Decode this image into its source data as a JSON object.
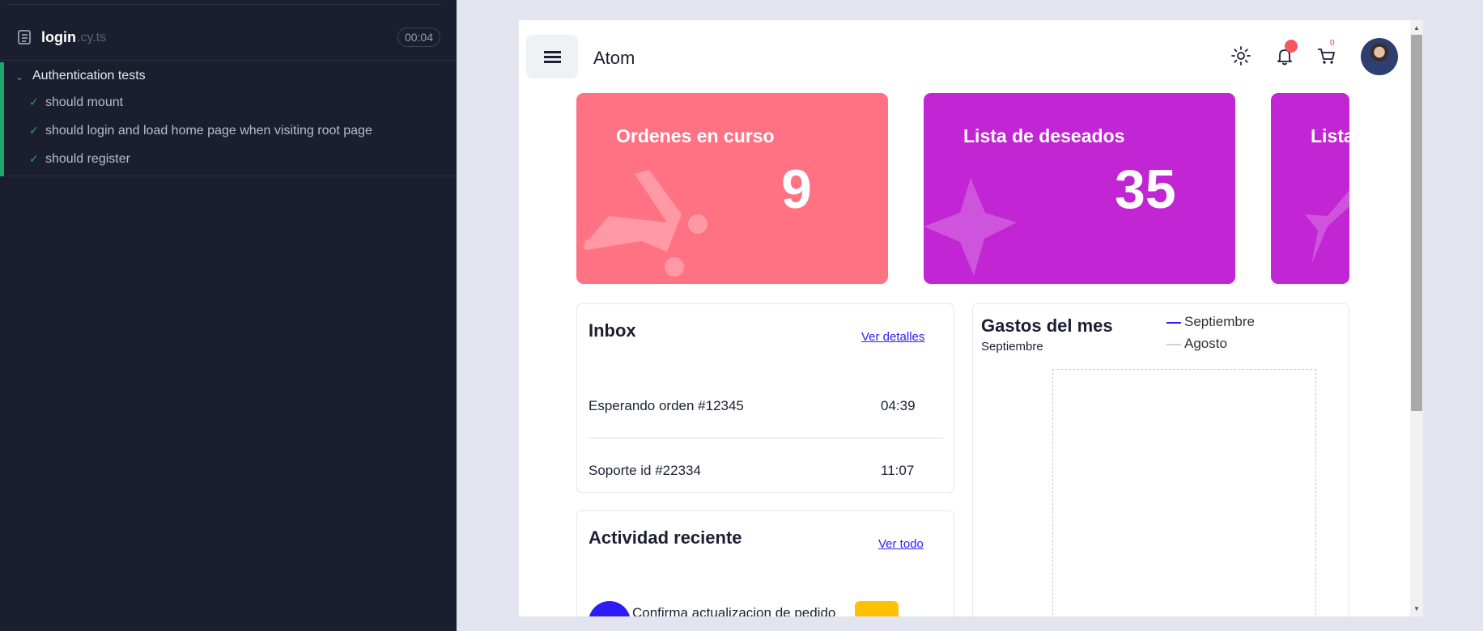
{
  "reporter": {
    "file_name": "login",
    "file_ext": ".cy.ts",
    "duration": "00:04",
    "suite_title": "Authentication tests",
    "tests": [
      "should mount",
      "should login and load home page when visiting root page",
      "should register"
    ],
    "pass_icon": "checkmark-icon",
    "pass_color": "#1fa971"
  },
  "header": {
    "title": "Atom",
    "cart_count": "0",
    "icons": [
      "menu-icon",
      "sun-icon",
      "bell-icon",
      "cart-icon",
      "avatar"
    ]
  },
  "cards": [
    {
      "label": "Ordenes en curso",
      "value": "9",
      "color": "#ff7284",
      "icon": "cart-icon"
    },
    {
      "label": "Lista de deseados",
      "value": "35",
      "color": "#c225d4",
      "icon": "star-icon"
    },
    {
      "label": "Lista",
      "color": "#c225d4",
      "icon": "star-icon"
    }
  ],
  "inbox": {
    "title": "Inbox",
    "link": "Ver detalles",
    "rows": [
      {
        "text": "Esperando orden #12345",
        "time": "04:39"
      },
      {
        "text": "Soporte id #22334",
        "time": "11:07"
      }
    ]
  },
  "activity": {
    "title": "Actividad reciente",
    "link": "Ver todo",
    "first_item": "Confirma actualizacion de pedido"
  },
  "expenses": {
    "title": "Gastos del mes",
    "subtitle": "Septiembre",
    "legend": [
      {
        "name": "Septiembre",
        "color": "#2d1cf5"
      },
      {
        "name": "Agosto",
        "color": "#cfd1d8"
      }
    ]
  }
}
